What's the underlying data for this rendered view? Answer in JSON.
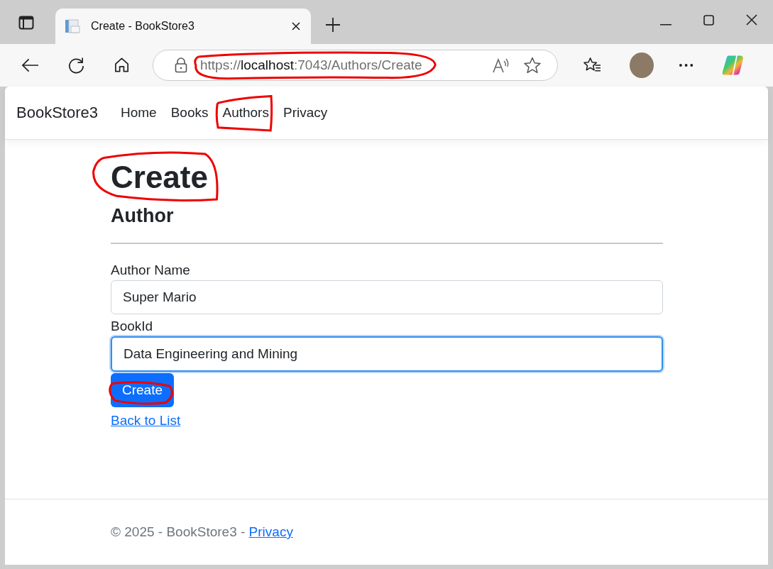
{
  "browser": {
    "tab_title": "Create - BookStore3",
    "url_scheme": "https://",
    "url_host": "localhost",
    "url_path": ":7043/Authors/Create"
  },
  "navbar": {
    "brand": "BookStore3",
    "links": [
      {
        "label": "Home"
      },
      {
        "label": "Books"
      },
      {
        "label": "Authors"
      },
      {
        "label": "Privacy"
      }
    ]
  },
  "page": {
    "title": "Create",
    "subtitle": "Author",
    "fields": [
      {
        "label": "Author Name",
        "value": "Super Mario",
        "focused": false
      },
      {
        "label": "BookId",
        "value": "Data Engineering and Mining",
        "focused": true
      }
    ],
    "submit": "Create",
    "back_link": "Back to List"
  },
  "footer": {
    "text": "© 2025 - BookStore3 - ",
    "link": "Privacy"
  }
}
